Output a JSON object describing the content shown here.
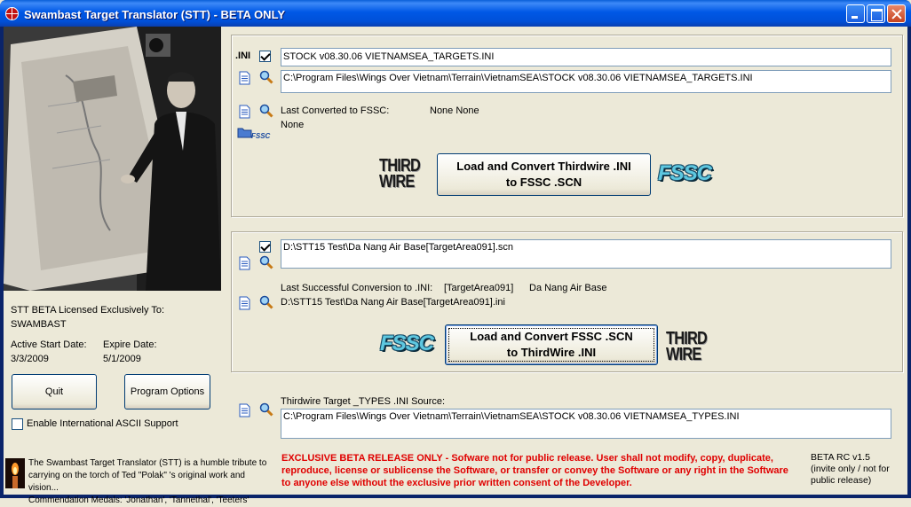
{
  "window": {
    "title": "Swambast Target Translator (STT) - BETA ONLY"
  },
  "license": {
    "licensed_to_label": "STT BETA Licensed Exclusively To:",
    "licensee": "SWAMBAST",
    "active_start_label": "Active Start Date:",
    "active_start_value": "3/3/2009",
    "expire_label": "Expire Date:",
    "expire_value": "5/1/2009"
  },
  "buttons": {
    "quit": "Quit",
    "program_options": "Program Options",
    "convert_ini_line1": "Load and Convert Thirdwire .INI",
    "convert_ini_line2": "to FSSC .SCN",
    "convert_scn_line1": "Load and Convert FSSC .SCN",
    "convert_scn_line2": "to ThirdWire .INI"
  },
  "options": {
    "intl_ascii_label": "Enable International ASCII Support",
    "intl_ascii_checked": false
  },
  "tribute": {
    "line1": "The Swambast Target Translator (STT) is a humble tribute to",
    "line2": "carrying on the torch of Ted \"Polak\" 's original work and vision...",
    "line3": "Commendation Medals:  'Jonathan', 'Tannethal', 'Teeters'"
  },
  "ini_panel": {
    "ini_label": ".INI",
    "ini_checked": true,
    "ini_name": "STOCK v08.30.06 VIETNAMSEA_TARGETS.INI",
    "ini_path": "C:\\Program Files\\Wings Over Vietnam\\Terrain\\VietnamSEA\\STOCK v08.30.06 VIETNAMSEA_TARGETS.INI",
    "last_converted_label": "Last Converted to FSSC:",
    "last_converted_value": "None  None",
    "last_converted_path": "None",
    "fssc_badge": "FSSC",
    "thirdwire_logo_line1": "THIRD",
    "thirdwire_logo_line2": "WIRE",
    "fssc_logo": "FSSC"
  },
  "scn_panel": {
    "scn_checked": true,
    "scn_path": "D:\\STT15 Test\\Da Nang Air Base[TargetArea091].scn",
    "last_success_label": "Last Successful Conversion to .INI:",
    "last_success_target": "[TargetArea091]",
    "last_success_name": "Da Nang Air Base",
    "last_success_path": "D:\\STT15 Test\\Da Nang Air Base[TargetArea091].ini",
    "fssc_logo": "FSSC",
    "thirdwire_logo_line1": "THIRD",
    "thirdwire_logo_line2": "WIRE"
  },
  "types_panel": {
    "label": "Thirdwire Target _TYPES .INI Source:",
    "path": "C:\\Program Files\\Wings Over Vietnam\\Terrain\\VietnamSEA\\STOCK v08.30.06 VIETNAMSEA_TYPES.INI"
  },
  "notice": {
    "text": "EXCLUSIVE BETA RELEASE ONLY - Sofware not for public release.  User shall not modify, copy, duplicate, reproduce, license or sublicense the Software, or transfer or convey the Software or any right in the Software to anyone else without the exclusive prior written consent of the Developer."
  },
  "version": {
    "line1": "BETA RC v1.5",
    "line2": "(invite only / not for public release)"
  },
  "colors": {
    "titlebar": "#0058e6",
    "window_bg": "#ece9d8",
    "notice_red": "#e00000"
  }
}
